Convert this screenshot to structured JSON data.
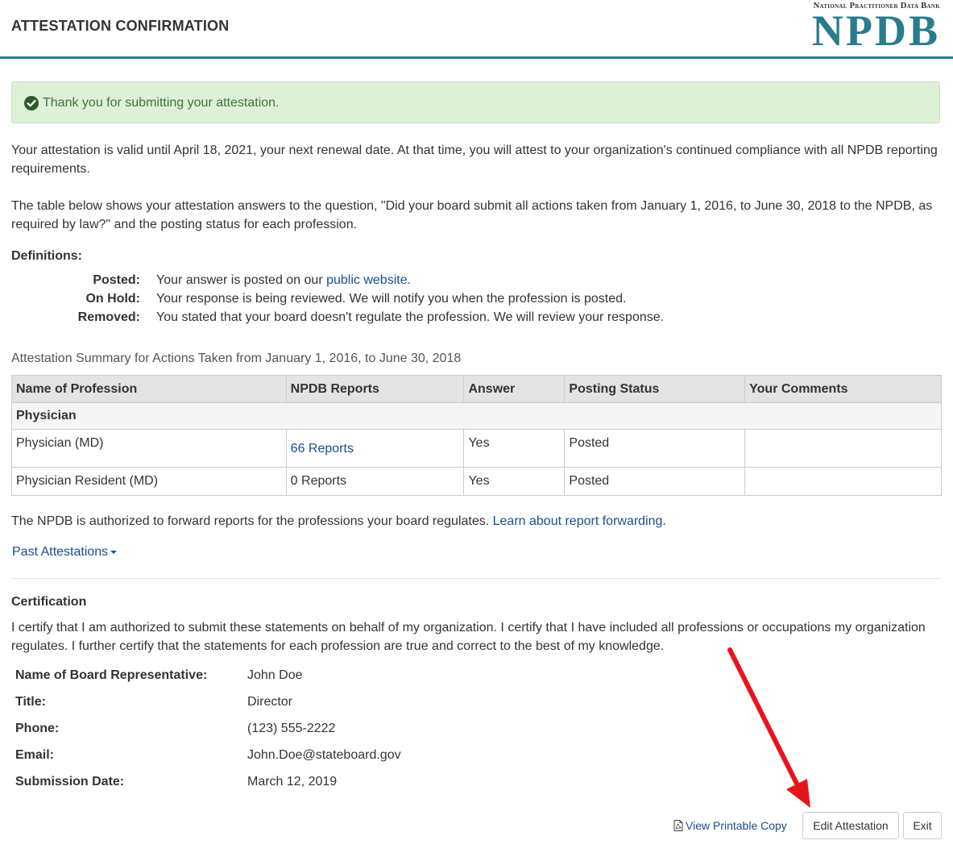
{
  "header": {
    "title": "ATTESTATION CONFIRMATION",
    "logo_sub": "National Practitioner Data Bank",
    "logo_main": "NPDB"
  },
  "alert": {
    "text": "Thank you for submitting your attestation.",
    "icon": "check-circle-icon",
    "color": "#3c763d"
  },
  "intro": {
    "validity": "Your attestation is valid until April 18, 2021, your next renewal date. At that time, you will attest to your organization's continued compliance with all NPDB reporting requirements.",
    "table_description": "The table below shows your attestation answers to the question, \"Did your board submit all actions taken from January 1, 2016, to June 30, 2018 to the NPDB, as required by law?\" and the posting status for each profession."
  },
  "definitions": {
    "heading": "Definitions:",
    "posted_term": "Posted:",
    "posted_desc_before": "Your answer is posted on our ",
    "posted_link": "public website",
    "posted_desc_after": ".",
    "onhold_term": "On Hold:",
    "onhold_desc": "Your response is being reviewed. We will notify you when the profession is posted.",
    "removed_term": "Removed:",
    "removed_desc": "You stated that your board doesn't regulate the profession. We will review your response."
  },
  "summary": {
    "caption": "Attestation Summary for Actions Taken from January 1, 2016, to June 30, 2018",
    "headers": [
      "Name of Profession",
      "NPDB Reports",
      "Answer",
      "Posting Status",
      "Your Comments"
    ],
    "group": "Physician",
    "rows": [
      {
        "profession": "Physician (MD)",
        "reports": "66 Reports",
        "answer": "Yes",
        "status": "Posted",
        "comments": ""
      },
      {
        "profession": "Physician Resident (MD)",
        "reports": "0 Reports",
        "answer": "Yes",
        "status": "Posted",
        "comments": ""
      }
    ]
  },
  "forwarding": {
    "text": "The NPDB is authorized to forward reports for the professions your board regulates. ",
    "link": "Learn about report forwarding",
    "after": "."
  },
  "past_attestations": "Past Attestations",
  "certification": {
    "heading": "Certification",
    "text": "I certify that I am authorized to submit these statements on behalf of my organization. I certify that I have included all professions or occupations my organization regulates. I further certify that the statements for each profession are true and correct to the best of my knowledge.",
    "fields": [
      {
        "label": "Name of Board Representative:",
        "value": "John Doe"
      },
      {
        "label": "Title:",
        "value": "Director"
      },
      {
        "label": "Phone:",
        "value": "(123) 555-2222"
      },
      {
        "label": "Email:",
        "value": "John.Doe@stateboard.gov"
      },
      {
        "label": "Submission Date:",
        "value": "March 12, 2019"
      }
    ]
  },
  "actions": {
    "print": "View Printable Copy",
    "edit": "Edit Attestation",
    "exit": "Exit"
  },
  "colors": {
    "brand": "#2a7b8c",
    "link": "#1a4d8f",
    "annotation_arrow": "#e8141b"
  }
}
